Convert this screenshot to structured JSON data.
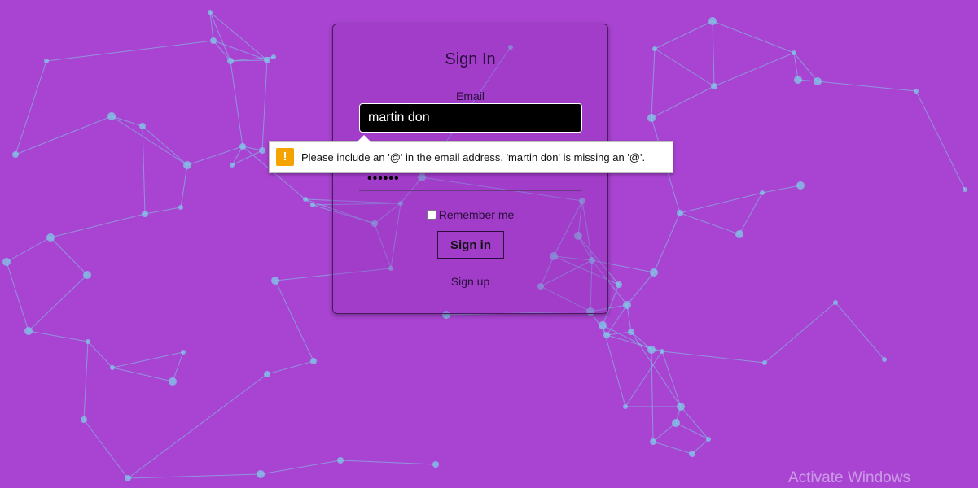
{
  "signin_form": {
    "title": "Sign In",
    "email_label": "Email",
    "email_value": "martin don",
    "password_value": "••••••",
    "remember_label": "Remember me",
    "signin_label": "Sign in",
    "signup_label": "Sign up"
  },
  "validation_tooltip": {
    "icon": "warning-icon",
    "message": "Please include an '@' in the email address. 'martin don' is missing an '@'."
  },
  "watermark": "Activate Windows",
  "colors": {
    "background": "#a944d2",
    "network_lines": "#7dd3e8",
    "warning": "#f5a300",
    "email_input_bg": "#000000"
  }
}
